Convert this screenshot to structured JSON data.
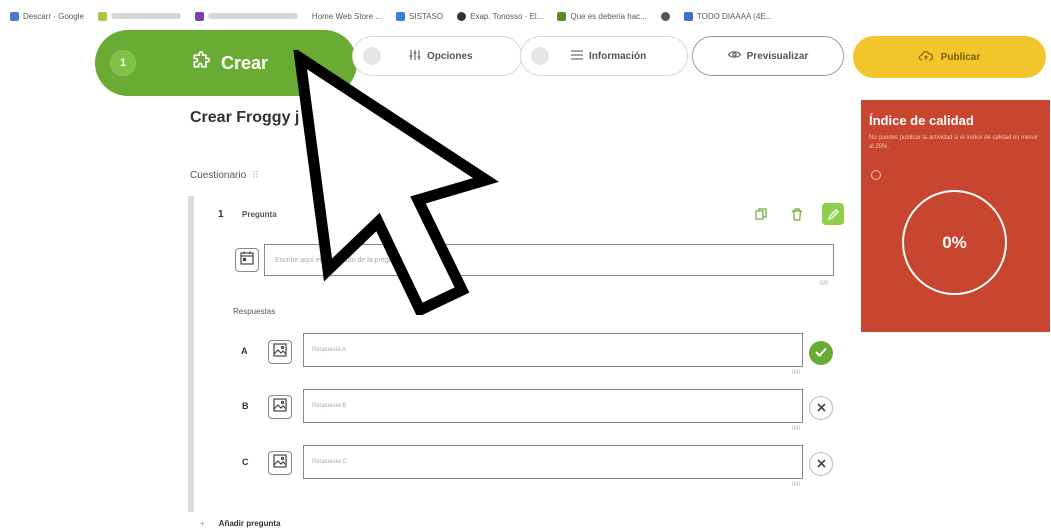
{
  "bookmarks": [
    {
      "label": "Descarr · Google",
      "color": "#4a7bd0"
    },
    {
      "label": "",
      "color": "#b4c23e"
    },
    {
      "label": "",
      "color": "#7b3fb0"
    },
    {
      "label": "Home Web Store ...",
      "color": ""
    },
    {
      "label": "SISTASO",
      "color": "#3a7de0"
    },
    {
      "label": "Exap. Tonosso · El...",
      "color": "#333333"
    },
    {
      "label": "Que es deberia hac...",
      "color": "#5b8a2a"
    },
    {
      "label": "",
      "color": "#555555"
    },
    {
      "label": "TODO DIAAAA (4E...",
      "color": "#3b6fd6"
    }
  ],
  "steps": {
    "crear": {
      "number": "1",
      "label": "Crear"
    },
    "opciones": {
      "label": "Opciones"
    },
    "informacion": {
      "label": "Información"
    },
    "previsualizar": {
      "label": "Previsualizar"
    },
    "publicar": {
      "label": "Publicar"
    }
  },
  "page": {
    "title": "Crear Froggy j",
    "section_label": "Cuestionario"
  },
  "question": {
    "number": "1",
    "label": "Pregunta",
    "placeholder": "Escribe aquí el enunciado de la pregunta",
    "counter": "0/0"
  },
  "answers": {
    "title": "Respuestas",
    "items": [
      {
        "letter": "A",
        "placeholder": "Respuesta A",
        "counter": "0/0",
        "correct": true
      },
      {
        "letter": "B",
        "placeholder": "Respuesta B",
        "counter": "0/0",
        "correct": false
      },
      {
        "letter": "C",
        "placeholder": "Respuesta C",
        "counter": "0/0",
        "correct": false
      }
    ]
  },
  "add_question": {
    "icon": "+",
    "label": "Añadir pregunta"
  },
  "quality": {
    "title": "Índice de calidad",
    "description": "No puedes publicar la actividad si el índice de calidad es menor al 25%.",
    "value": "0%",
    "color": "#c8452f"
  },
  "colors": {
    "accent_green": "#6aab33",
    "publish_yellow": "#f2c52a"
  }
}
